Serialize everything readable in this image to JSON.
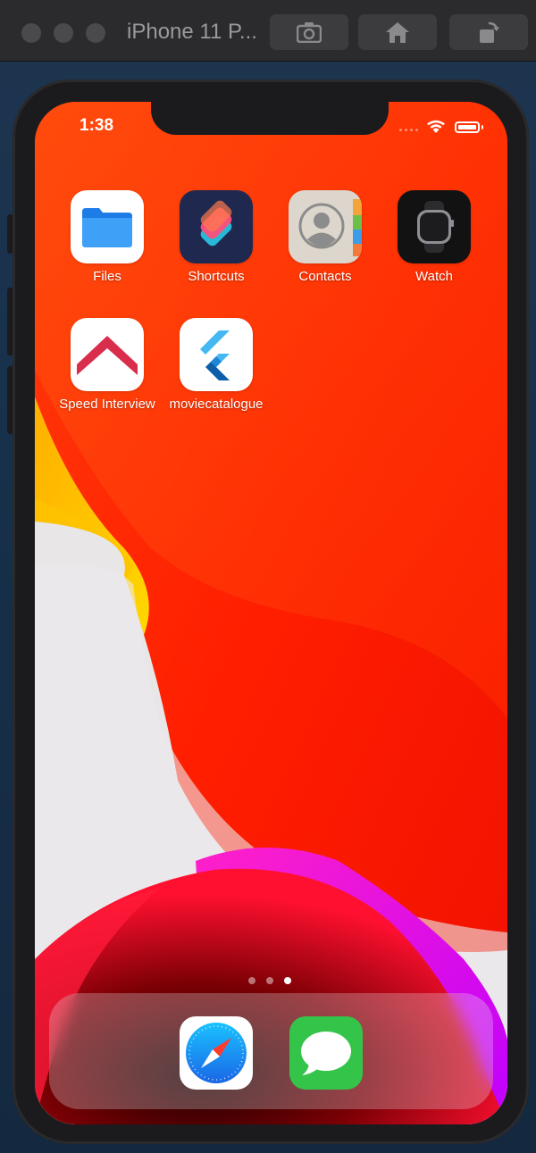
{
  "simulator": {
    "title": "iPhone 11 P...",
    "buttons": [
      "screenshot-icon",
      "home-icon",
      "rotate-icon"
    ]
  },
  "status_bar": {
    "time": "1:38",
    "icons": [
      "signal-dots-icon",
      "wifi-icon",
      "battery-icon"
    ]
  },
  "home_screen": {
    "apps": [
      {
        "label": "Files",
        "icon": "files-icon"
      },
      {
        "label": "Shortcuts",
        "icon": "shortcuts-icon"
      },
      {
        "label": "Contacts",
        "icon": "contacts-icon"
      },
      {
        "label": "Watch",
        "icon": "watch-icon"
      },
      {
        "label": "Speed Interview",
        "icon": "speed-interview-icon"
      },
      {
        "label": "moviecatalogue",
        "icon": "flutter-icon"
      }
    ],
    "page_count": 3,
    "active_page": 3
  },
  "dock": {
    "apps": [
      {
        "icon": "safari-icon"
      },
      {
        "icon": "messages-icon"
      }
    ]
  },
  "colors": {
    "wallpaper_red": "#ff2200",
    "wallpaper_yellow": "#ffcf00",
    "wallpaper_magenta": "#e011e6",
    "wallpaper_white": "#e8e6e8"
  }
}
